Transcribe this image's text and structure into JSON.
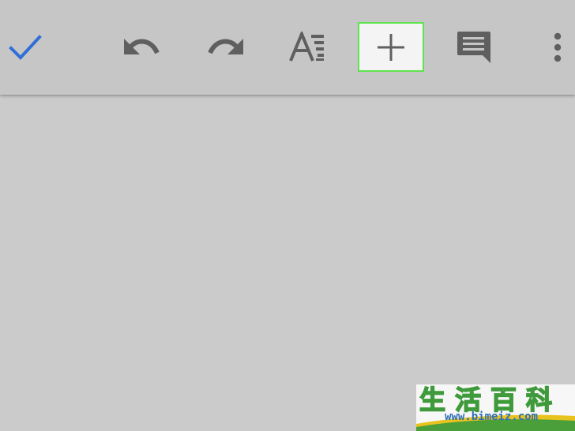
{
  "toolbar": {
    "buttons": [
      {
        "name": "done-checkmark",
        "icon": "check-icon",
        "color": "#2f6fd6"
      },
      {
        "name": "undo",
        "icon": "undo-icon",
        "color": "#5f5f5f"
      },
      {
        "name": "redo",
        "icon": "redo-icon",
        "color": "#5f5f5f"
      },
      {
        "name": "text-format",
        "icon": "text-format-icon",
        "color": "#5f5f5f"
      },
      {
        "name": "insert",
        "icon": "plus-icon",
        "color": "#5f5f5f",
        "highlighted": true,
        "highlight_color": "#5fe34f"
      },
      {
        "name": "comment",
        "icon": "comment-icon",
        "color": "#5f5f5f"
      },
      {
        "name": "more-options",
        "icon": "more-vertical-icon",
        "color": "#5f5f5f"
      }
    ]
  },
  "colors": {
    "toolbar_bg": "#c6c6c6",
    "document_bg": "#cbcbcb",
    "accent": "#2f6fd6",
    "highlight": "#5fe34f"
  },
  "watermark": {
    "title": "生活百科",
    "url": "www.bimeiz.com",
    "title_color": "#3e9a3a",
    "url_color": "#2f6fb8"
  }
}
